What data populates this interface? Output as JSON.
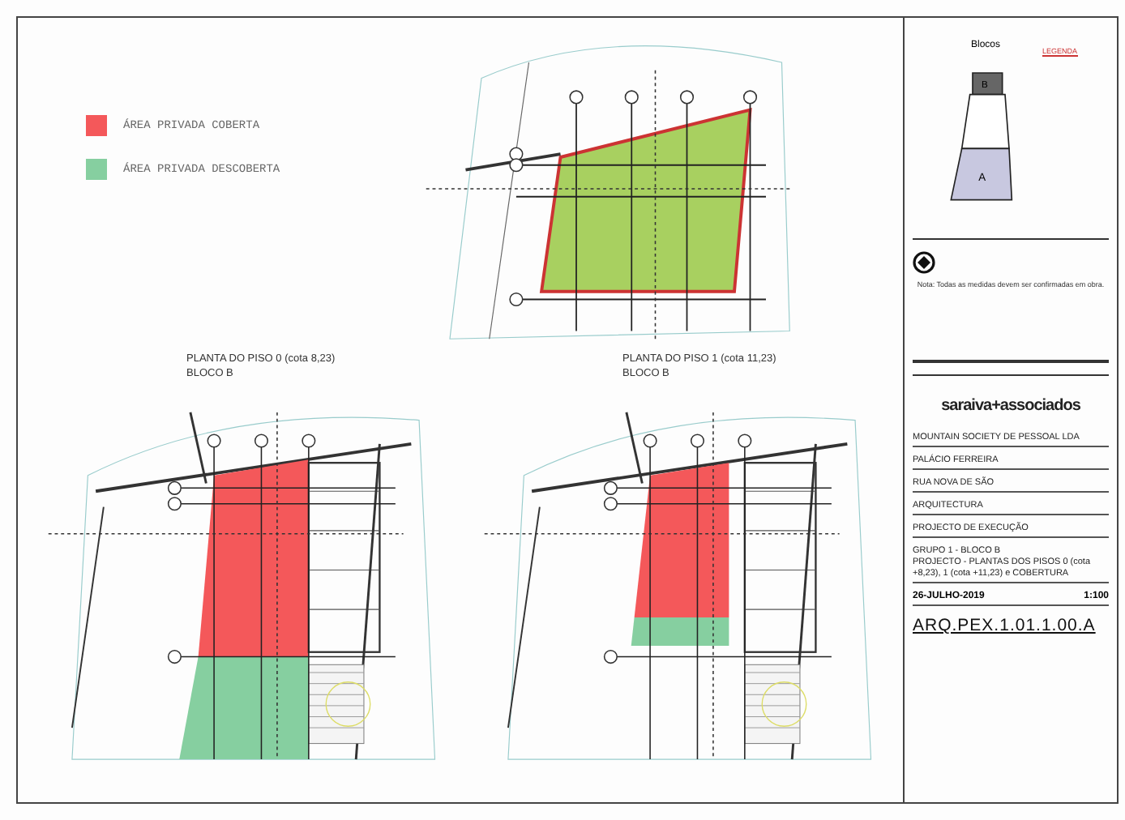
{
  "legend": [
    {
      "label": "ÁREA PRIVADA COBERTA",
      "color": "#f4585a"
    },
    {
      "label": "ÁREA PRIVADA DESCOBERTA",
      "color": "#86cfa0"
    }
  ],
  "plans": [
    {
      "kind": "roof"
    },
    {
      "kind": "floor0",
      "title": "PLANTA DO PISO 0 (cota 8,23)",
      "subtitle": "BLOCO B"
    },
    {
      "kind": "floor1",
      "title": "PLANTA DO PISO 1 (cota 11,23)",
      "subtitle": "BLOCO B"
    }
  ],
  "key_plan": {
    "title": "Blocos",
    "legend_title": "LEGENDA",
    "blocks": [
      "B",
      "A"
    ]
  },
  "note": "Nota: Todas as medidas devem ser confirmadas em obra.",
  "title_block": {
    "logo": "saraiva+associados",
    "fields": [
      "MOUNTAIN SOCIETY DE PESSOAL LDA",
      "PALÁCIO FERREIRA",
      "RUA NOVA DE SÃO",
      "ARQUITECTURA",
      "PROJECTO DE EXECUÇÃO",
      "GRUPO 1 - BLOCO B\nPROJECTO - PLANTAS DOS PISOS 0 (cota +8,23), 1 (cota +11,23) e COBERTURA"
    ],
    "date": "26-JULHO-2019",
    "scale": "1:100",
    "code": "ARQ.PEX.1.01.1.00.A"
  }
}
